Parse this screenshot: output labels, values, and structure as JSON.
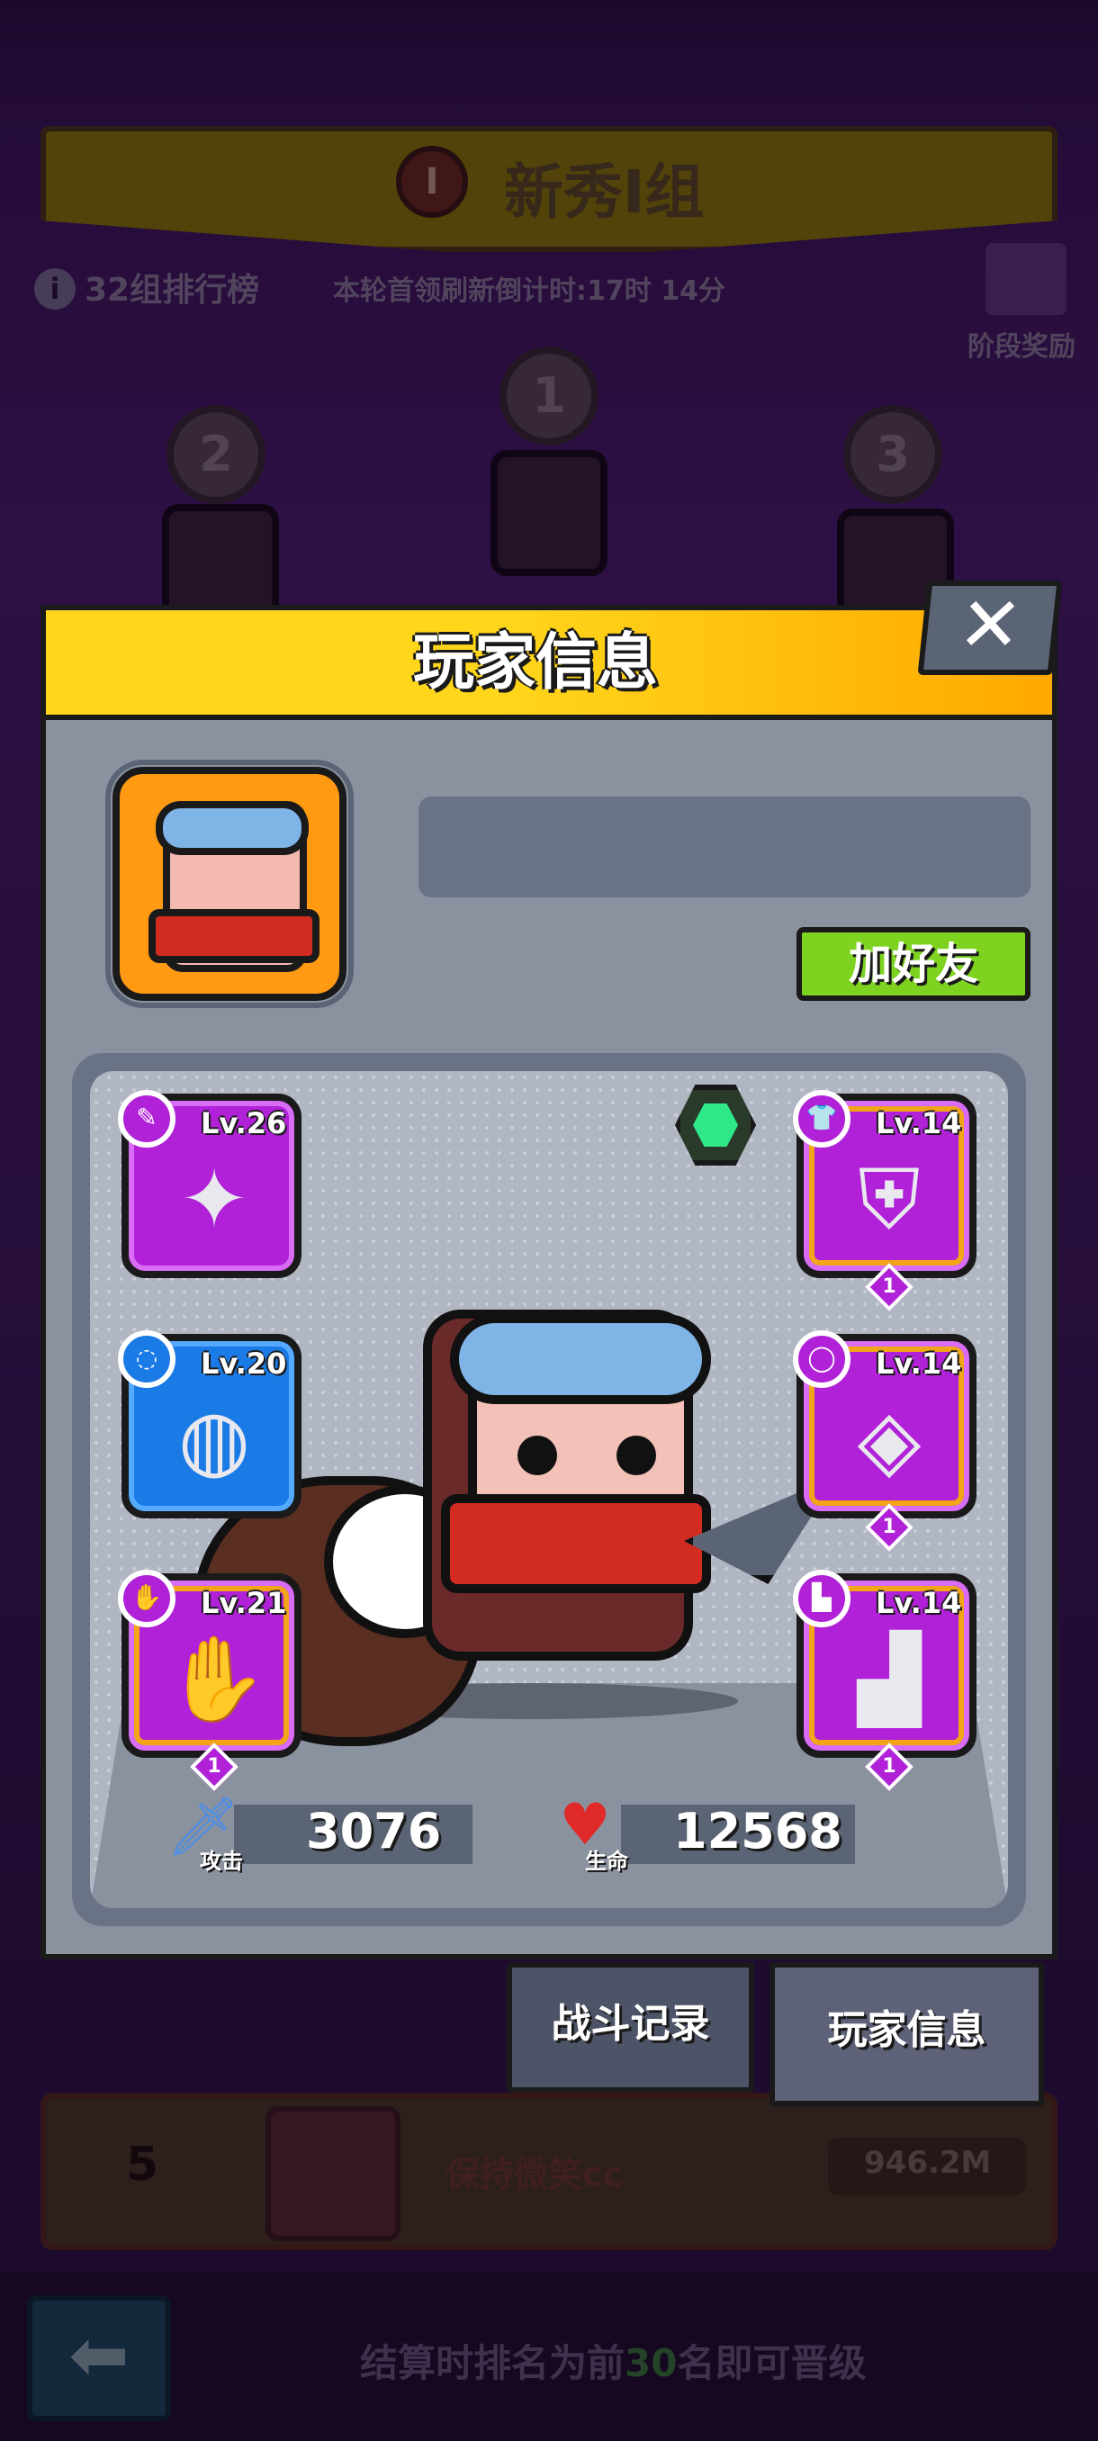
{
  "header": {
    "banner_badge": "I",
    "banner_title": "新秀I组",
    "info_icon": "i",
    "rank_label": "32组排行榜",
    "countdown": "本轮首领刷新倒计时:17时 14分",
    "stage_reward_label": "阶段奖励"
  },
  "podium": {
    "first": "1",
    "second": "2",
    "third": "3"
  },
  "bottom_row": {
    "rank": "5",
    "name": "保持微笑cc",
    "score": "946.2M"
  },
  "footer": {
    "back_icon": "⬅",
    "text_before": "结算时排名为前",
    "text_highlight": "30",
    "text_after": "名即可晋级"
  },
  "modal": {
    "title": "玩家信息",
    "close_icon": "✕",
    "add_friend_label": "加好友",
    "equipment": {
      "weapon": {
        "level": "Lv.26",
        "icon": "kunai-icon",
        "glyph": "✦"
      },
      "belt": {
        "level": "Lv.20",
        "icon": "belt-icon",
        "glyph": "◍"
      },
      "gloves": {
        "level": "Lv.21",
        "icon": "glove-icon",
        "glyph": "✋",
        "tier": "1"
      },
      "armor": {
        "level": "Lv.14",
        "icon": "armor-icon",
        "glyph": "⛨",
        "tier": "1"
      },
      "ring": {
        "level": "Lv.14",
        "icon": "ring-icon",
        "glyph": "◈",
        "tier": "1"
      },
      "boots": {
        "level": "Lv.14",
        "icon": "boots-icon",
        "glyph": "▟",
        "tier": "1"
      }
    },
    "stats": {
      "attack_caption": "攻击",
      "attack_value": "3076",
      "hp_caption": "生命",
      "hp_value": "12568"
    }
  },
  "tabs": {
    "battle_log": "战斗记录",
    "player_info": "玩家信息"
  },
  "colors": {
    "header_yellow": "#ffd61c",
    "rare_purple": "#b021d8",
    "uncommon_blue": "#1b7be6",
    "friend_green": "#7ed321",
    "highlight_green": "#3a7a3a"
  }
}
